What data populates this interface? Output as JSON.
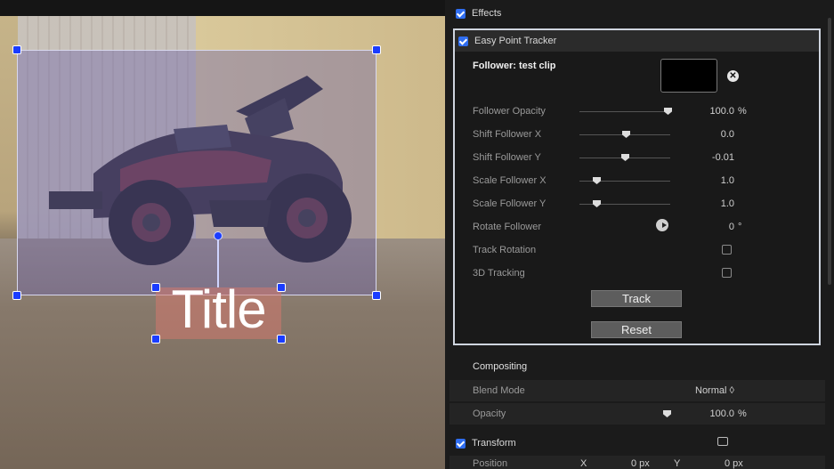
{
  "viewer": {
    "title_text": "Title"
  },
  "panel": {
    "effects_label": "Effects",
    "tracker": {
      "name": "Easy Point Tracker",
      "follower_label": "Follower: test clip",
      "follower_opacity": {
        "label": "Follower Opacity",
        "value": "100.0",
        "unit": "%",
        "level": 1.0
      },
      "shift_x": {
        "label": "Shift Follower X",
        "value": "0.0",
        "level": 0.5
      },
      "shift_y": {
        "label": "Shift Follower Y",
        "value": "-0.01",
        "level": 0.49
      },
      "scale_x": {
        "label": "Scale Follower X",
        "value": "1.0",
        "level": 0.18
      },
      "scale_y": {
        "label": "Scale Follower Y",
        "value": "1.0",
        "level": 0.18
      },
      "rotate": {
        "label": "Rotate Follower",
        "value": "0",
        "unit": "°"
      },
      "track_rotation": {
        "label": "Track Rotation"
      },
      "tracking_3d": {
        "label": "3D Tracking"
      },
      "track_button": "Track",
      "reset_button": "Reset"
    },
    "compositing": {
      "label": "Compositing",
      "blend_mode": {
        "label": "Blend Mode",
        "value": "Normal ◊"
      },
      "opacity": {
        "label": "Opacity",
        "value": "100.0",
        "unit": "%"
      }
    },
    "transform": {
      "label": "Transform",
      "position_label": "Position",
      "x_label": "X",
      "x_value": "0 px",
      "y_label": "Y",
      "y_value": "0 px"
    }
  },
  "colors": {
    "accent": "#2f6df0",
    "handle": "#1a3cff"
  }
}
